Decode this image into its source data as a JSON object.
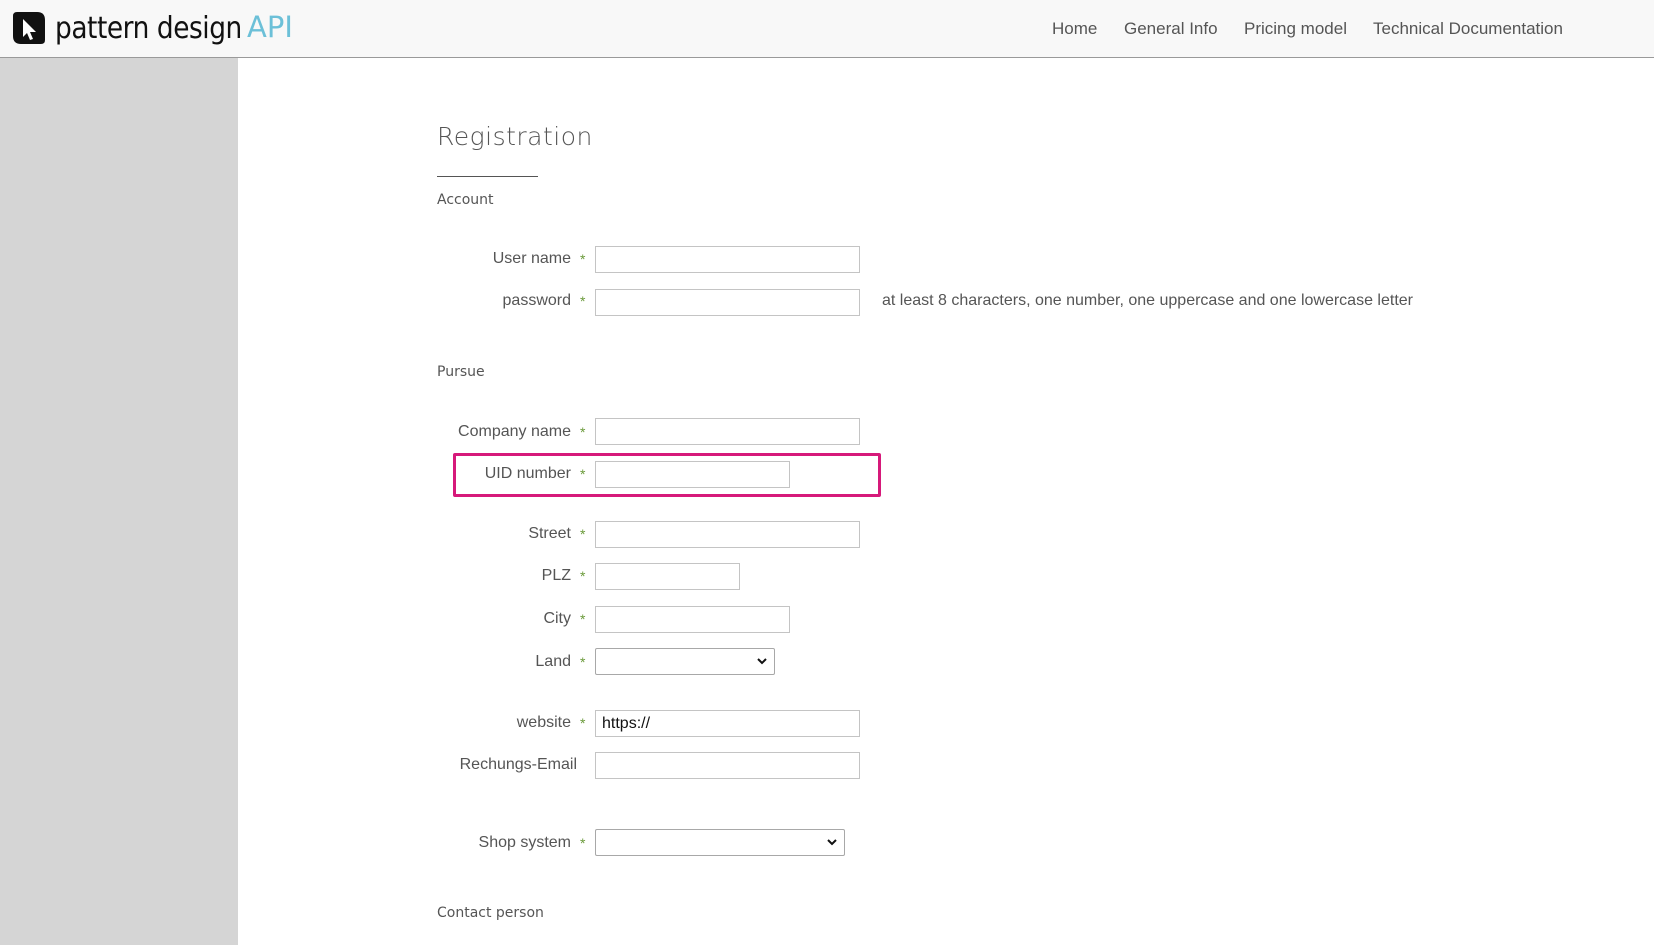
{
  "header": {
    "logo_text": "pattern design",
    "logo_suffix": "API",
    "nav": [
      "Home",
      "General Info",
      "Pricing model",
      "Technical Documentation"
    ]
  },
  "page": {
    "title": "Registration",
    "sections": {
      "account": "Account",
      "pursue": "Pursue",
      "contact": "Contact person"
    }
  },
  "form": {
    "required_marker": "*",
    "username_label": "User name",
    "password_label": "password",
    "password_hint": "at least 8 characters, one number, one uppercase and one lowercase letter",
    "company_label": "Company name",
    "uid_label": "UID number",
    "street_label": "Street",
    "plz_label": "PLZ",
    "city_label": "City",
    "land_label": "Land",
    "land_value": "",
    "website_label": "website",
    "website_value": "https://",
    "invoice_email_label": "Rechungs-Email",
    "shop_system_label": "Shop system",
    "shop_system_value": ""
  },
  "colors": {
    "accent_api": "#6cc0d8",
    "highlight": "#d6197a",
    "required": "#6a9a3a",
    "sidebar": "#d5d5d5"
  }
}
